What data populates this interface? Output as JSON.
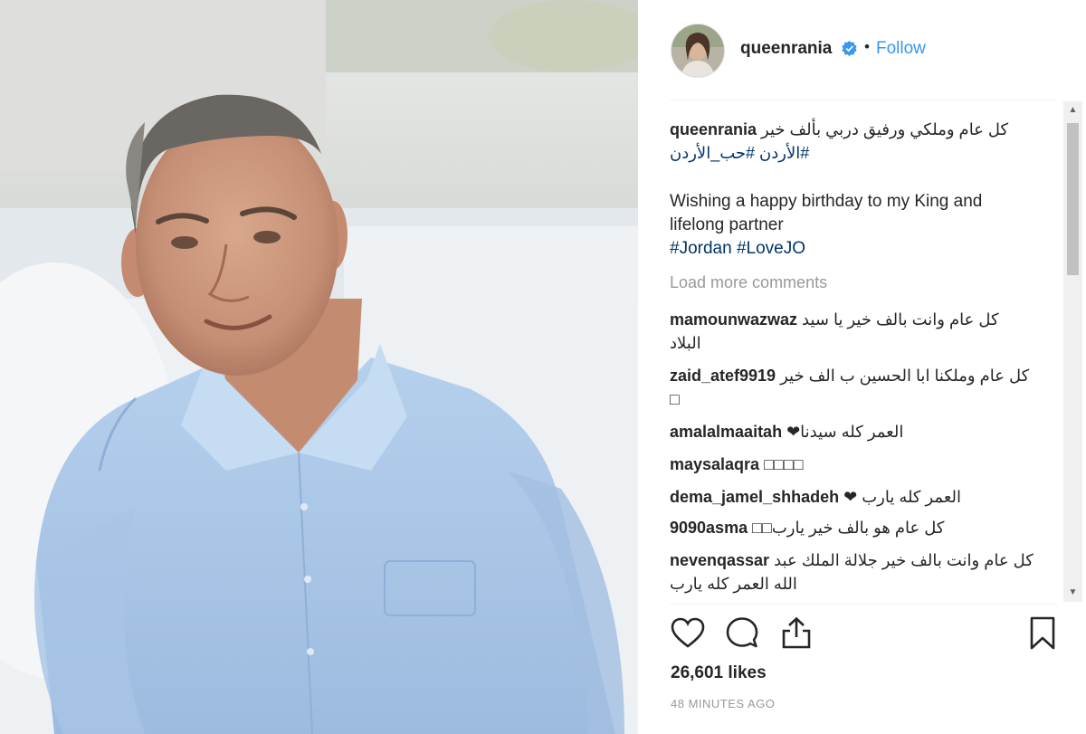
{
  "post": {
    "username": "queenrania",
    "separator": "•",
    "follow_label": "Follow",
    "caption_user": "queenrania",
    "caption_arabic": "كل عام وملكي ورفيق دربي بألف خير",
    "caption_arabic_tags": "#الأردن #حب_الأردن",
    "caption_english_line1": "Wishing a happy birthday to my King and",
    "caption_english_line2": "lifelong partner",
    "caption_english_tags": "#Jordan #LoveJO",
    "load_more_label": "Load more comments",
    "likes": "26,601 likes",
    "time_ago": "48 MINUTES AGO"
  },
  "comments": [
    {
      "user": "mamounwazwaz",
      "text": "كل عام وانت بالف خير يا سيد",
      "text2": "البلاد"
    },
    {
      "user": "zaid_atef9919",
      "text": "كل عام وملكنا ابا الحسين ب الف خير",
      "text2": "□"
    },
    {
      "user": "amalalmaaitah",
      "text": "العمر كله سيدنا❤",
      "text2": ""
    },
    {
      "user": "maysalaqra",
      "text": "□□□□",
      "text2": ""
    },
    {
      "user": "dema_jamel_shhadeh",
      "text": "العمر كله يارب ❤",
      "text2": ""
    },
    {
      "user": "9090asma",
      "text": "كل عام هو بالف خير يارب□□",
      "text2": ""
    },
    {
      "user": "nevenqassar",
      "text": "كل عام وانت بالف خير جلالة الملك عبد",
      "text2": "الله العمر كله يارب"
    }
  ],
  "icons": {
    "verified": "verified-badge-icon",
    "like": "heart-icon",
    "comment": "comment-bubble-icon",
    "share": "share-icon",
    "save": "bookmark-icon"
  },
  "colors": {
    "link_blue": "#3897f0",
    "hashtag": "#003569",
    "muted": "#999999",
    "text": "#262626"
  }
}
